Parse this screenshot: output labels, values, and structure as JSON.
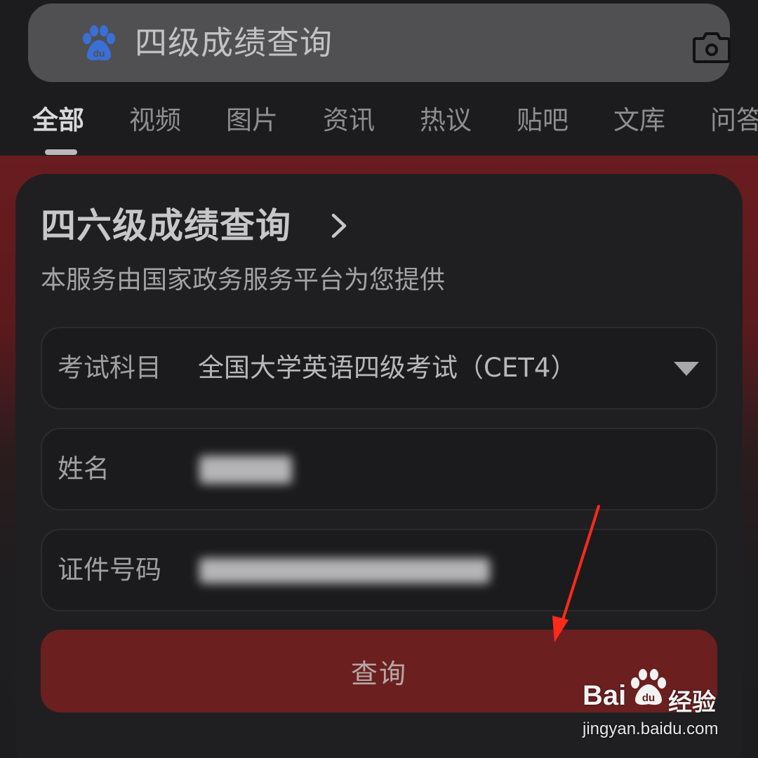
{
  "search": {
    "query": "四级成绩查询",
    "logo_icon": "baidu-paw-icon",
    "camera_icon": "camera-icon"
  },
  "tabs": [
    {
      "label": "全部",
      "active": true
    },
    {
      "label": "视频",
      "active": false
    },
    {
      "label": "图片",
      "active": false
    },
    {
      "label": "资讯",
      "active": false
    },
    {
      "label": "热议",
      "active": false
    },
    {
      "label": "贴吧",
      "active": false
    },
    {
      "label": "文库",
      "active": false
    },
    {
      "label": "问答",
      "active": false
    }
  ],
  "card": {
    "title": "四六级成绩查询",
    "subtitle": "本服务由国家政务服务平台为您提供",
    "fields": {
      "subject": {
        "label": "考试科目",
        "value": "全国大学英语四级考试（CET4）"
      },
      "name": {
        "label": "姓名"
      },
      "id_number": {
        "label": "证件号码"
      }
    },
    "submit_label": "查询"
  },
  "colors": {
    "accent_red": "#6b1f1f",
    "banner_red": "#6a1c1f",
    "annotation_red": "#ff2a1a"
  },
  "watermark": {
    "brand": "Bai",
    "brand_cn": "经验",
    "url": "jingyan.baidu.com"
  }
}
